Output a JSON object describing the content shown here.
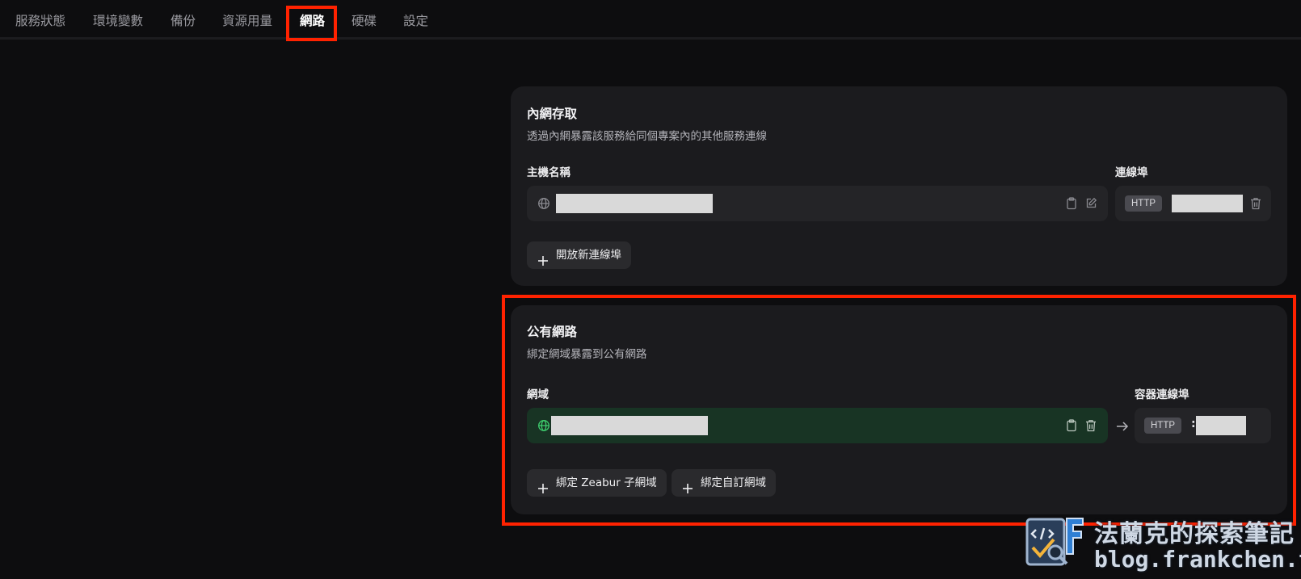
{
  "tabs": [
    {
      "label": "服務狀態"
    },
    {
      "label": "環境變數"
    },
    {
      "label": "備份"
    },
    {
      "label": "資源用量"
    },
    {
      "label": "網路",
      "active": true
    },
    {
      "label": "硬碟"
    },
    {
      "label": "設定"
    }
  ],
  "internal": {
    "title": "內網存取",
    "description": "透過內網暴露該服務給同個專案內的其他服務連線",
    "hostname_label": "主機名稱",
    "hostname_value": "",
    "port_label": "連線埠",
    "port_protocol": "HTTP",
    "port_value": "",
    "add_port_button": "開放新連線埠"
  },
  "public": {
    "title": "公有網路",
    "description": "綁定網域暴露到公有網路",
    "domain_label": "網域",
    "domain_value": "",
    "container_port_label": "容器連線埠",
    "port_protocol": "HTTP",
    "port_value": "",
    "bind_zeabur_button": "綁定 Zeabur 子網域",
    "bind_custom_button": "綁定自訂網域"
  },
  "watermark": {
    "title": "法蘭克的探索筆記",
    "url": "blog.frankchen.tw"
  },
  "colors": {
    "highlight": "#ff2200",
    "domain_field_bg": "#183424",
    "globe_active": "#3ecf6e"
  },
  "icons": {
    "globe": "globe-icon",
    "copy": "clipboard-icon",
    "edit": "edit-icon",
    "delete": "trash-icon",
    "arrow": "arrow-right-icon",
    "plus": "plus-icon"
  }
}
